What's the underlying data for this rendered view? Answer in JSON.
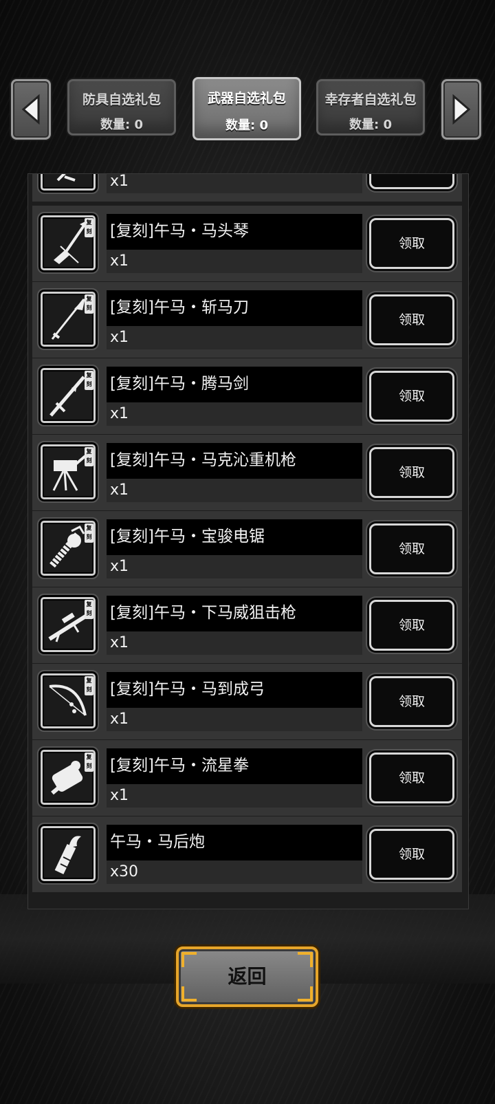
{
  "tabs": [
    {
      "label": "防具自选礼包",
      "count": "数量: 0",
      "active": false
    },
    {
      "label": "武器自选礼包",
      "count": "数量: 0",
      "active": true
    },
    {
      "label": "幸存者自选礼包",
      "count": "数量: 0",
      "active": false
    }
  ],
  "badge_text": "复刻",
  "items": [
    {
      "name": "",
      "qty": "x1",
      "icon": "partial-weapon-icon"
    },
    {
      "name": "[复刻]午马・马头琴",
      "qty": "x1",
      "icon": "horse-head-fiddle-icon"
    },
    {
      "name": "[复刻]午马・斩马刀",
      "qty": "x1",
      "icon": "zhanma-blade-icon"
    },
    {
      "name": "[复刻]午马・腾马剑",
      "qty": "x1",
      "icon": "tengma-sword-icon"
    },
    {
      "name": "[复刻]午马・马克沁重机枪",
      "qty": "x1",
      "icon": "maxim-machine-gun-icon"
    },
    {
      "name": "[复刻]午马・宝骏电锯",
      "qty": "x1",
      "icon": "chainsaw-icon"
    },
    {
      "name": "[复刻]午马・下马威狙击枪",
      "qty": "x1",
      "icon": "sniper-rifle-icon"
    },
    {
      "name": "[复刻]午马・马到成弓",
      "qty": "x1",
      "icon": "bow-icon"
    },
    {
      "name": "[复刻]午马・流星拳",
      "qty": "x1",
      "icon": "meteor-fist-icon"
    },
    {
      "name": "午马・马后炮",
      "qty": "x30",
      "icon": "horse-cannon-icon"
    }
  ],
  "claim_label": "领取",
  "back_label": "返回"
}
